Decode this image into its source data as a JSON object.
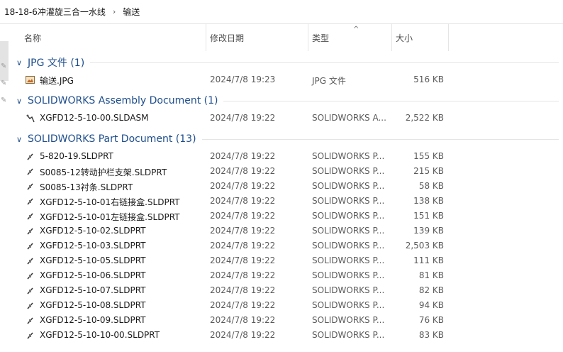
{
  "breadcrumb": {
    "items": [
      "18-18-6冲灌旋三合一水线",
      "输送"
    ],
    "separator": "›"
  },
  "columns": {
    "name": "名称",
    "date": "修改日期",
    "type": "类型",
    "size": "大小"
  },
  "groups": [
    {
      "title": "JPG 文件 (1)",
      "files": [
        {
          "name": "输送.JPG",
          "date": "2024/7/8 19:23",
          "type": "JPG 文件",
          "size": "516 KB",
          "icon": "image-icon"
        }
      ]
    },
    {
      "title": "SOLIDWORKS Assembly Document (1)",
      "files": [
        {
          "name": "XGFD12-5-10-00.SLDASM",
          "date": "2024/7/8 19:22",
          "type": "SOLIDWORKS A...",
          "size": "2,522 KB",
          "icon": "assembly-icon"
        }
      ]
    },
    {
      "title": "SOLIDWORKS Part Document (13)",
      "files": [
        {
          "name": "5-820-19.SLDPRT",
          "date": "2024/7/8 19:22",
          "type": "SOLIDWORKS P...",
          "size": "155 KB",
          "icon": "part-icon"
        },
        {
          "name": "S0085-12转动护栏支架.SLDPRT",
          "date": "2024/7/8 19:22",
          "type": "SOLIDWORKS P...",
          "size": "215 KB",
          "icon": "part-icon"
        },
        {
          "name": "S0085-13衬条.SLDPRT",
          "date": "2024/7/8 19:22",
          "type": "SOLIDWORKS P...",
          "size": "58 KB",
          "icon": "part-icon"
        },
        {
          "name": "XGFD12-5-10-01右链接盒.SLDPRT",
          "date": "2024/7/8 19:22",
          "type": "SOLIDWORKS P...",
          "size": "138 KB",
          "icon": "part-icon"
        },
        {
          "name": "XGFD12-5-10-01左链接盒.SLDPRT",
          "date": "2024/7/8 19:22",
          "type": "SOLIDWORKS P...",
          "size": "151 KB",
          "icon": "part-icon"
        },
        {
          "name": "XGFD12-5-10-02.SLDPRT",
          "date": "2024/7/8 19:22",
          "type": "SOLIDWORKS P...",
          "size": "139 KB",
          "icon": "part-icon"
        },
        {
          "name": "XGFD12-5-10-03.SLDPRT",
          "date": "2024/7/8 19:22",
          "type": "SOLIDWORKS P...",
          "size": "2,503 KB",
          "icon": "part-icon"
        },
        {
          "name": "XGFD12-5-10-05.SLDPRT",
          "date": "2024/7/8 19:22",
          "type": "SOLIDWORKS P...",
          "size": "111 KB",
          "icon": "part-icon"
        },
        {
          "name": "XGFD12-5-10-06.SLDPRT",
          "date": "2024/7/8 19:22",
          "type": "SOLIDWORKS P...",
          "size": "81 KB",
          "icon": "part-icon"
        },
        {
          "name": "XGFD12-5-10-07.SLDPRT",
          "date": "2024/7/8 19:22",
          "type": "SOLIDWORKS P...",
          "size": "82 KB",
          "icon": "part-icon"
        },
        {
          "name": "XGFD12-5-10-08.SLDPRT",
          "date": "2024/7/8 19:22",
          "type": "SOLIDWORKS P...",
          "size": "94 KB",
          "icon": "part-icon"
        },
        {
          "name": "XGFD12-5-10-09.SLDPRT",
          "date": "2024/7/8 19:22",
          "type": "SOLIDWORKS P...",
          "size": "76 KB",
          "icon": "part-icon"
        },
        {
          "name": "XGFD12-5-10-10-00.SLDPRT",
          "date": "2024/7/8 19:22",
          "type": "SOLIDWORKS P...",
          "size": "83 KB",
          "icon": "part-icon"
        }
      ]
    }
  ],
  "colors": {
    "group_title": "#1e4e8c",
    "muted_text": "#5a5a5a"
  }
}
